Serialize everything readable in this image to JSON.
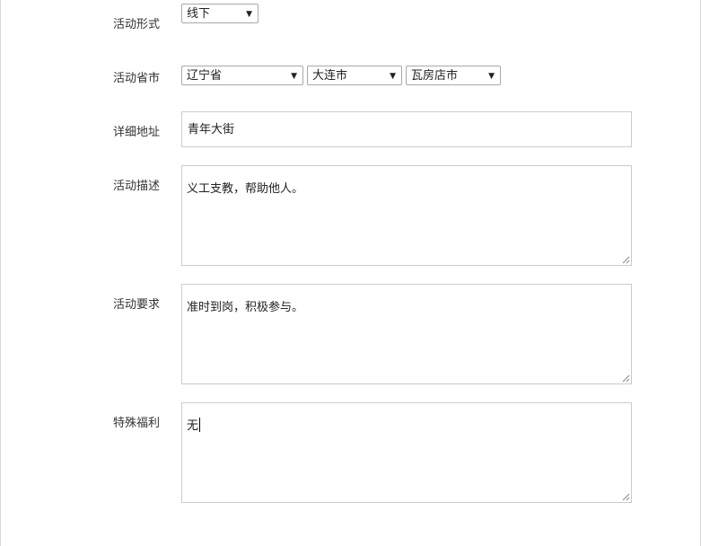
{
  "form": {
    "activity_form": {
      "label": "活动形式",
      "value": "线下"
    },
    "province_city": {
      "label": "活动省市",
      "province": "辽宁省",
      "city": "大连市",
      "district": "瓦房店市"
    },
    "address": {
      "label": "详细地址",
      "value": "青年大街"
    },
    "description": {
      "label": "活动描述",
      "value": "义工支教，帮助他人。"
    },
    "requirements": {
      "label": "活动要求",
      "value": "准时到岗，积极参与。"
    },
    "benefits": {
      "label": "特殊福利",
      "value": "无"
    }
  },
  "icons": {
    "dropdown": "chevron-down-icon",
    "resize": "resize-grip-icon"
  },
  "colors": {
    "border": "#cccccc",
    "select_border": "#a9a9a9",
    "text": "#333333"
  }
}
